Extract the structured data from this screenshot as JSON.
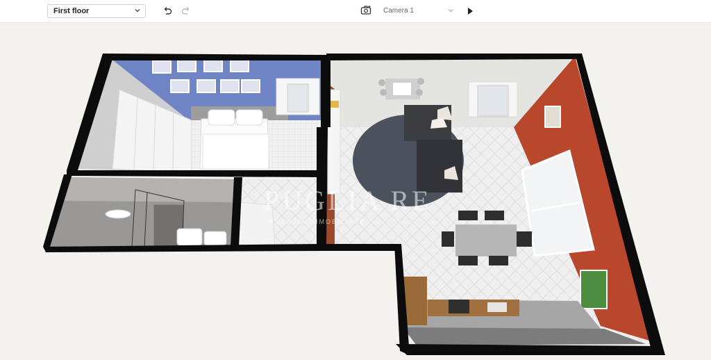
{
  "toolbar": {
    "floor_value": "First floor",
    "undo_icon": "undo-icon",
    "redo_icon": "redo-icon",
    "camera_icon": "camera-add-icon",
    "camera_value": "Camera 1",
    "play_icon": "play-icon"
  },
  "watermark": {
    "name": "PUGLIA RE",
    "subtitle": "AGENZIA IMMOBILIARE"
  },
  "colors": {
    "blue_wall": "#6f84c4",
    "red_wall": "#b8472c",
    "wall": "#0c0c0c",
    "floor": "#ebebeb"
  }
}
